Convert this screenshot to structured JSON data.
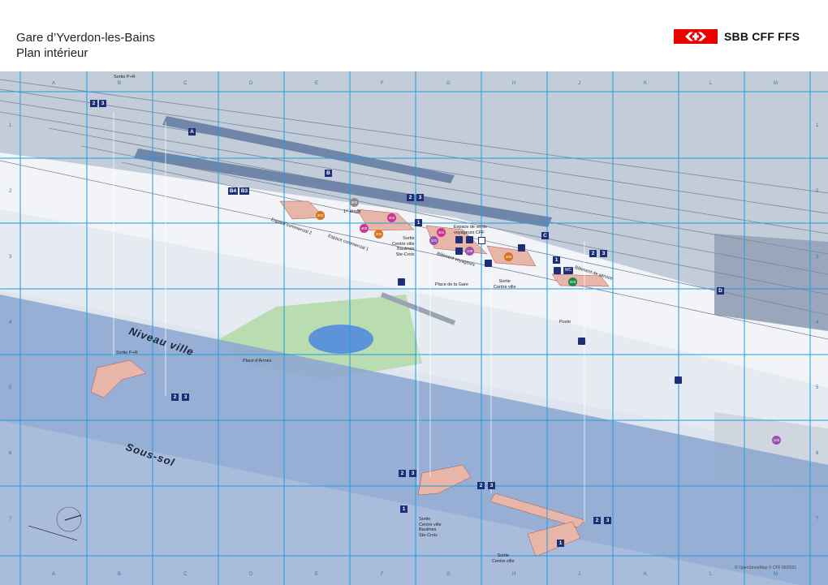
{
  "header": {
    "title_line1": "Gare d’Yverdon-les-Bains",
    "title_line2": "Plan intérieur",
    "brand": "SBB CFF FFS"
  },
  "colors": {
    "brand": "#eb0000",
    "grid": "#1f9ce0",
    "badge": "#1e2f7a",
    "underground": "#8fa8d0",
    "track_bg": "#c6d0de"
  },
  "grid": {
    "cols": [
      "A",
      "B",
      "C",
      "D",
      "E",
      "F",
      "G",
      "H",
      "J",
      "K",
      "L",
      "M"
    ],
    "rows": [
      "1",
      "2",
      "3",
      "4",
      "5",
      "6",
      "7"
    ]
  },
  "levels": {
    "street": "Niveau ville",
    "basement": "Sous-sol",
    "first_floor": "1ᵉʳ étage"
  },
  "platforms": {
    "a": "A",
    "b": "B",
    "c": "C",
    "d": "D",
    "b4": "B4",
    "b3": "B3"
  },
  "tracks": {
    "one": "1",
    "two": "2",
    "three": "3"
  },
  "labels": {
    "sortie_pr": "Sortie P+R",
    "place_gare": "Place de la Gare",
    "place_armes": "Place d’Armes",
    "poste": "Poste",
    "espace_vente_1": "Espace de vente",
    "espace_vente_2": "voyageurs CFF",
    "sortie": "Sortie",
    "centre_ville": "Centre ville",
    "baulmes": "Baulmes",
    "ste_croix": "Ste-Croix",
    "esp_com_2": "Espace commercial 2",
    "esp_com_1": "Espace commercial 1",
    "bat_voy": "Bâtiment voyageurs",
    "bat_serv": "Bâtiment de service",
    "wc": "WC"
  },
  "pois": {
    "p100": "100",
    "p101": "101",
    "p102": "102",
    "p203": "203",
    "p300": "300",
    "p301": "301",
    "p302": "302",
    "p400": "400",
    "p401": "401",
    "p402": "402",
    "p500": "500"
  },
  "credit": "© OpenStreetMap  © CFF 05/2021"
}
